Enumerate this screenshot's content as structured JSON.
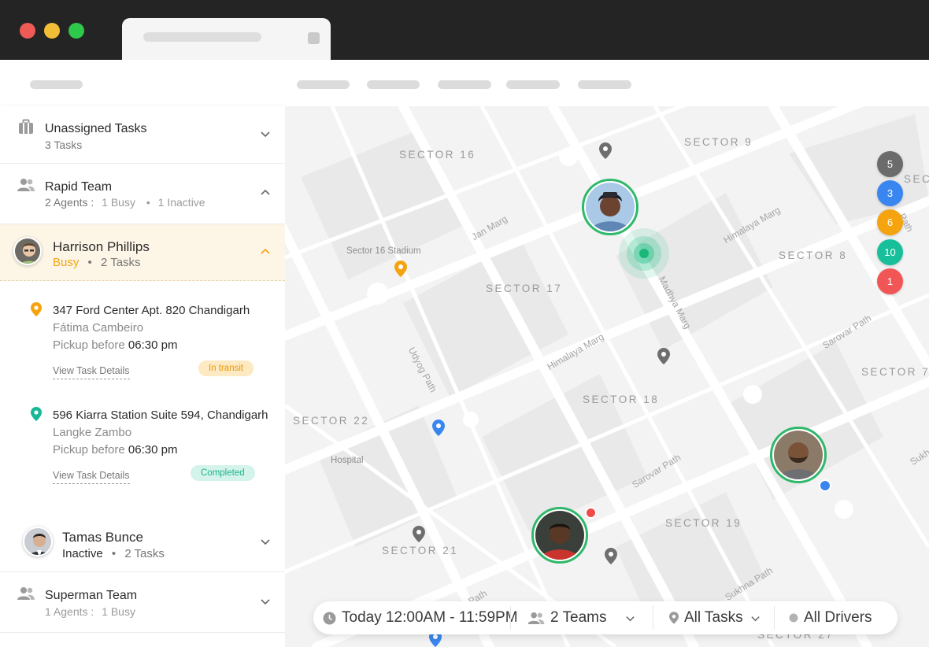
{
  "sidebar": {
    "unassigned": {
      "title": "Unassigned Tasks",
      "sub": "3 Tasks"
    },
    "rapid_team": {
      "title": "Rapid Team",
      "agents": "2 Agents :",
      "busy": "1 Busy",
      "inactive": "1 Inactive"
    },
    "agent_open": {
      "name": "Harrison Phillips",
      "status": "Busy",
      "tasks": "2 Tasks",
      "task_list": [
        {
          "address": "347 Ford Center Apt. 820 Chandigarh",
          "customer": "Fátima Cambeiro",
          "pickup_label": "Pickup before",
          "pickup_time": "06:30 pm",
          "details": "View Task Details",
          "status": "In transit",
          "pin_color": "#f5a30f"
        },
        {
          "address": "596 Kiarra Station Suite 594, Chandigarh",
          "customer": "Langke Zambo",
          "pickup_label": "Pickup before",
          "pickup_time": "06:30 pm",
          "details": "View Task Details",
          "status": "Completed",
          "pin_color": "#17b897"
        }
      ]
    },
    "agent_closed": {
      "name": "Tamas Bunce",
      "status": "Inactive",
      "tasks": "2 Tasks"
    },
    "superman_team": {
      "title": "Superman Team",
      "agents": "1 Agents :",
      "busy": "1 Busy"
    }
  },
  "map": {
    "sectors": [
      "SECTOR 16",
      "SECTOR 9",
      "SECTOR 8",
      "SECTOR 17",
      "SECTOR 7",
      "SECTOR 18",
      "SECTOR 22",
      "SECTOR 19",
      "SECTOR 21",
      "SECTOR 27",
      "SEC"
    ],
    "roads": [
      "Jan Marg",
      "Himalaya Marg",
      "Madhya Marg",
      "Himalaya Marg",
      "Udyog Path",
      "Sarovar Path",
      "Sarovar Path",
      "Sukhna Path",
      "Path",
      "Path",
      "Sukh"
    ],
    "places": [
      "Sector 16 Stadium",
      "Hospital"
    ],
    "clusters": [
      {
        "value": "5",
        "color": "#6b6b6b"
      },
      {
        "value": "3",
        "color": "#3a86f0"
      },
      {
        "value": "6",
        "color": "#f5a30f"
      },
      {
        "value": "10",
        "color": "#17c09a"
      },
      {
        "value": "1",
        "color": "#f25555"
      }
    ]
  },
  "filters": {
    "time": "Today 12:00AM - 11:59PM",
    "teams": "2 Teams",
    "tasks": "All Tasks",
    "drivers": "All Drivers"
  },
  "colors": {
    "accent_busy": "#f5a30f",
    "driver_ring": "#2fb86a"
  }
}
